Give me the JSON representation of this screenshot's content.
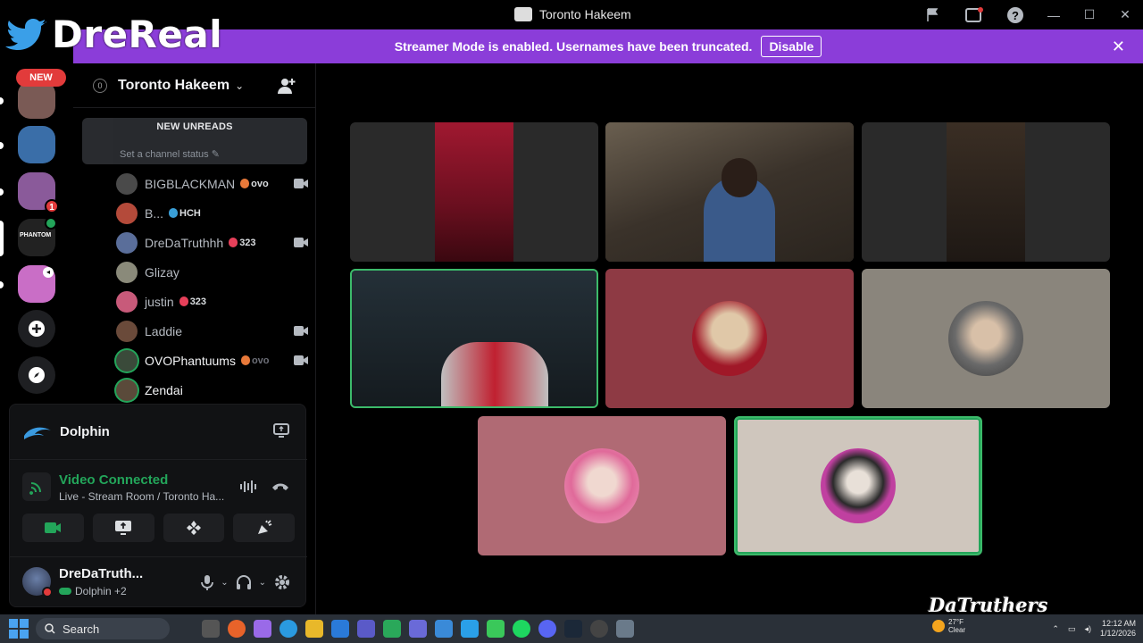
{
  "window": {
    "title": "Toronto Hakeem",
    "icons": [
      "flag-icon",
      "inbox-icon",
      "help-icon"
    ],
    "controls": [
      "minimize",
      "maximize",
      "close"
    ]
  },
  "watermark": {
    "text": "DreReal"
  },
  "banner": {
    "message": "Streamer Mode is enabled. Usernames have been truncated.",
    "button": "Disable"
  },
  "rail": {
    "new_pill": "NEW",
    "servers": [
      {
        "name": "server-1",
        "color": "#7a5a55"
      },
      {
        "name": "server-2",
        "color": "#3a6ea8"
      },
      {
        "name": "server-3",
        "color": "#8a5a9a",
        "badge": "1"
      },
      {
        "name": "server-4",
        "color": "#222222",
        "label": "PHANTOM"
      },
      {
        "name": "server-5",
        "color": "#c96ec6"
      }
    ]
  },
  "server": {
    "name": "Toronto Hakeem",
    "boost": "0"
  },
  "unreads": {
    "label": "NEW UNREADS",
    "channel_status": "Set a channel status"
  },
  "voice_users": [
    {
      "name": "BIGBLACKMAN",
      "tag": "ovo",
      "tag_style": "orange",
      "camera": true,
      "bright": false,
      "avatar": "#4a4a4a"
    },
    {
      "name": "B...",
      "tag": "HCH",
      "tag_style": "blue",
      "camera": false,
      "bright": false,
      "avatar": "#b44a3a"
    },
    {
      "name": "DreDaTruthhh",
      "tag": "323",
      "tag_style": "red",
      "camera": true,
      "bright": false,
      "avatar": "#5a6e9a"
    },
    {
      "name": "Glizay",
      "tag": "",
      "tag_style": "",
      "camera": false,
      "bright": false,
      "avatar": "#8a8a7a"
    },
    {
      "name": "justin",
      "tag": "323",
      "tag_style": "red",
      "camera": false,
      "bright": false,
      "avatar": "#c85a7a"
    },
    {
      "name": "Laddie",
      "tag": "",
      "tag_style": "",
      "camera": true,
      "bright": false,
      "avatar": "#6a4a3a"
    },
    {
      "name": "OVOPhantuums",
      "tag": "ovo",
      "tag_style": "orange-dim",
      "camera": true,
      "bright": true,
      "avatar": "#3a4a3a",
      "speaking": true
    },
    {
      "name": "Zendai",
      "tag": "",
      "tag_style": "",
      "camera": false,
      "bright": true,
      "avatar": "#5a4a3a",
      "speaking": true
    }
  ],
  "panel": {
    "activity": "Dolphin",
    "voice_status": "Video Connected",
    "voice_channel": "Live - Stream Room / Toronto Ha...",
    "user_name": "DreDaTruth...",
    "user_sub": "Dolphin +2"
  },
  "tiles": [
    {
      "name": "video-tile-1",
      "bg": "#2a2a2a"
    },
    {
      "name": "video-tile-2",
      "bg": "#4a4238"
    },
    {
      "name": "video-tile-3",
      "bg": "#2a2a2a"
    },
    {
      "name": "video-tile-4",
      "bg": "#1a2228",
      "speaking": true
    },
    {
      "name": "avatar-tile-5",
      "bg": "#8e3a44"
    },
    {
      "name": "avatar-tile-6",
      "bg": "#8a857c"
    },
    {
      "name": "avatar-tile-7",
      "bg": "#b06a74"
    },
    {
      "name": "avatar-tile-8",
      "bg": "#cfc6bd",
      "speaking": true
    }
  ],
  "brandmark": "DaTruthers",
  "taskbar": {
    "search": "Search",
    "weather_temp": "27°F",
    "weather_desc": "Clear",
    "time": "12:12 AM",
    "date": "1/12/2026"
  }
}
